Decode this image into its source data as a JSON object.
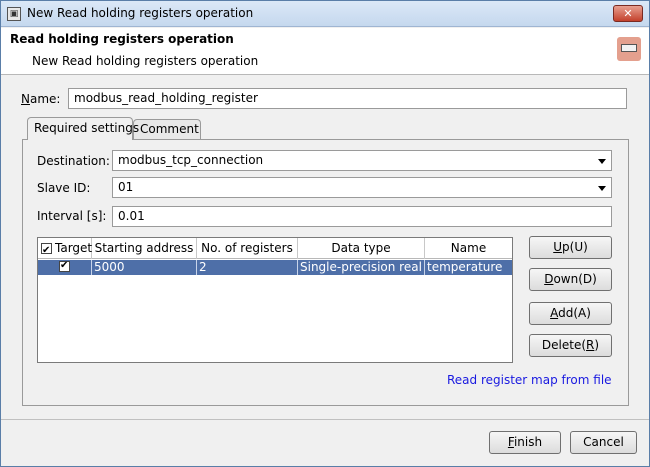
{
  "window": {
    "title": "New Read holding registers operation",
    "close_label": "✕"
  },
  "header": {
    "title": "Read holding registers operation",
    "subtitle": "New Read holding registers operation"
  },
  "name_field": {
    "label_mnemonic": "N",
    "label_rest": "ame:",
    "value": "modbus_read_holding_register"
  },
  "tabs": [
    {
      "label": "Required settings"
    },
    {
      "label": "Comment"
    }
  ],
  "destination": {
    "label": "Destination:",
    "value": "modbus_tcp_connection"
  },
  "slave_id": {
    "label": "Slave ID:",
    "value": "01"
  },
  "interval": {
    "label": "Interval [s]:",
    "value": "0.01"
  },
  "table": {
    "headers": [
      "Target",
      "Starting address",
      "No. of registers",
      "Data type",
      "Name"
    ],
    "rows": [
      {
        "target": true,
        "starting_address": "5000",
        "registers": "2",
        "data_type": "Single-precision real",
        "name": "temperature"
      }
    ]
  },
  "side_buttons": {
    "up": {
      "pre": "",
      "mnemonic": "U",
      "post": "p(U)"
    },
    "down": {
      "pre": "",
      "mnemonic": "D",
      "post": "own(D)"
    },
    "add": {
      "pre": "",
      "mnemonic": "A",
      "post": "dd(A)"
    },
    "delete": {
      "pre": "Delete(",
      "mnemonic": "R",
      "post": ")"
    }
  },
  "link_text": "Read register map from file",
  "footer": {
    "finish": {
      "mnemonic": "F",
      "rest": "inish"
    },
    "cancel": "Cancel"
  }
}
